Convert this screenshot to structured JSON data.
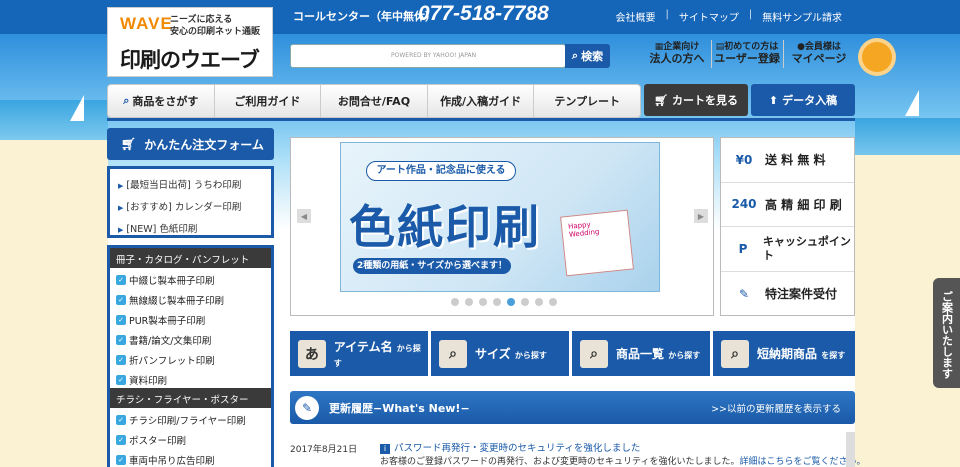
{
  "header": {
    "logo_wave": "WAVE",
    "logo_tagline": [
      "ニーズに応える",
      "安心の印刷ネット通販"
    ],
    "logo_name": "印刷のウエーブ",
    "call_center_label": "コールセンター（年中無休）",
    "phone": "077-518-7788",
    "top_links": [
      "会社概要",
      "サイトマップ",
      "無料サンプル請求"
    ],
    "search_powered": "POWERED BY YAHOO! JAPAN",
    "search_button": "検索",
    "quick_links": [
      {
        "small": "企業向け",
        "big": "法人の方へ",
        "icon": "building-icon"
      },
      {
        "small": "初めての方は",
        "big": "ユーザー登録",
        "icon": "book-icon"
      },
      {
        "small": "会員様は",
        "big": "マイページ",
        "icon": "user-icon"
      }
    ]
  },
  "nav": {
    "items": [
      "商品をさがす",
      "ご利用ガイド",
      "お問合せ/FAQ",
      "作成/入稿ガイド",
      "テンプレート"
    ],
    "cart": "カートを見る",
    "data_upload": "データ入稿"
  },
  "left": {
    "order_form": "かんたん注文フォーム",
    "campaign": [
      "[最短当日出荷] うちわ印刷",
      "[おすすめ] カレンダー印刷",
      "[NEW] 色紙印刷"
    ],
    "categories": [
      {
        "heading": "冊子・カタログ・パンフレット",
        "items": [
          "中綴じ製本冊子印刷",
          "無線綴じ製本冊子印刷",
          "PUR製本冊子印刷",
          "書籍/論文/文集印刷",
          "折パンフレット印刷",
          "資料印刷"
        ]
      },
      {
        "heading": "チラシ・フライヤー・ポスター",
        "items": [
          "チラシ印刷/フライヤー印刷",
          "ポスター印刷",
          "車両中吊り広告印刷"
        ]
      }
    ]
  },
  "banner": {
    "tag": "アート作品・記念品に使える",
    "title": "色紙印刷",
    "sub": "2種類の用紙・サイズから選べます！",
    "card_text": "Happy Wedding",
    "dots": 8,
    "active_dot": 5
  },
  "features": [
    {
      "icon": "¥0",
      "label": "送 料 無 料"
    },
    {
      "icon": "240",
      "label": "高 精 細 印 刷"
    },
    {
      "icon": "P",
      "label": "キャッシュポイント"
    },
    {
      "icon": "✎",
      "label": "特注案件受付"
    }
  ],
  "search_tiles": [
    {
      "main": "アイテム名",
      "sub": "から探す",
      "icon": "あ"
    },
    {
      "main": "サイズ",
      "sub": "から探す",
      "icon": "⌕"
    },
    {
      "main": "商品一覧",
      "sub": "から探す",
      "icon": "⌕"
    },
    {
      "main": "短納期商品",
      "sub": "を探す",
      "icon": "⌕"
    }
  ],
  "news": {
    "bar_title": "更新履歴−What's New!−",
    "bar_link": ">>以前の更新履歴を表示する",
    "date": "2017年8月21日",
    "title": "パスワード再発行・変更時のセキュリティを強化しました",
    "body": "お客様のご登録パスワードの再発行、および変更時のセキュリティを強化いたしました。",
    "body_link": "詳細はこちらをご覧ください。"
  },
  "side_tab": "ご案内いたします",
  "colors": {
    "primary": "#1a5aa8",
    "dark": "#3a3a3a",
    "accent": "#f08a00"
  }
}
